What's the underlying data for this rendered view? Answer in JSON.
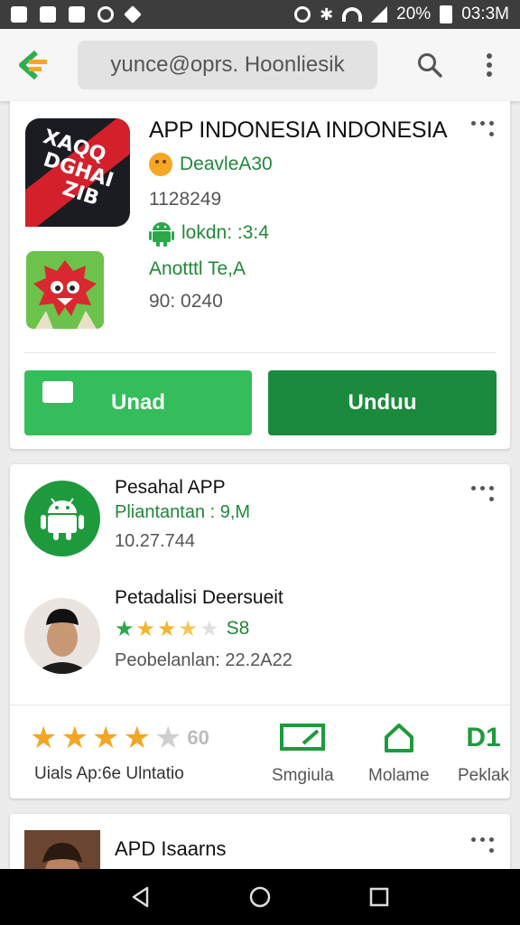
{
  "status_bar": {
    "battery_text": "20%",
    "time": "03:3M"
  },
  "toolbar": {
    "search_value": "yunce@oprs. Hoonliesik",
    "search_icon": "search-icon",
    "more_icon": "more-vert-icon",
    "logo_icon": "back-logo-icon",
    "accent_color": "#f5a623",
    "brand_green": "#1a8a3c"
  },
  "card1": {
    "title": "APP INDONESIA INDONESIA",
    "developer": "DeavleA30",
    "id_text": "1128249",
    "android_text": "lokdn: :3:4",
    "extra_green": "Anotttl Te,A",
    "version": "90: 0240",
    "button_left": "Unad",
    "button_right": "Unduu"
  },
  "card2": {
    "item1": {
      "title": "Pesahal APP",
      "subtitle": "Pliantantan : 9,M",
      "number": "10.27.744"
    },
    "item2": {
      "title": "Petadalisi Deersueit",
      "rating_text": "S8",
      "stars": 3.5,
      "date": "Peobelanlan: 22.2A22"
    },
    "rating": {
      "stars": 4,
      "number": "60",
      "label": "Uials Ap:6e Ulntatio"
    },
    "actions": [
      {
        "label": "Smgiula",
        "icon": "share-screen-icon"
      },
      {
        "label": "Molame",
        "icon": "home-icon"
      },
      {
        "label": "Peklak",
        "icon": "d1-icon",
        "glyph": "D1"
      }
    ]
  },
  "card3": {
    "title": "APD Isaarns"
  },
  "nav": {
    "back": "back-triangle-icon",
    "home": "home-circle-icon",
    "recents": "recents-square-icon"
  }
}
